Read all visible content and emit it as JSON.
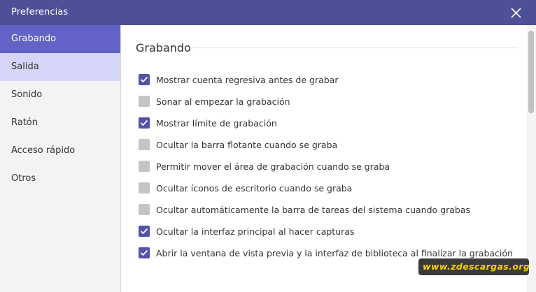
{
  "window": {
    "title": "Preferencias"
  },
  "colors": {
    "titlebar": "#4e4f99",
    "accent": "#6163c6",
    "hover": "#d5d6f7",
    "checkbox_on": "#5352a8",
    "checkbox_off": "#c4c4c4"
  },
  "icons": {
    "close": "close-icon",
    "check": "checkmark-icon"
  },
  "sidebar": {
    "items": [
      {
        "label": "Grabando",
        "state": "selected"
      },
      {
        "label": "Salida",
        "state": "hover"
      },
      {
        "label": "Sonido",
        "state": "normal"
      },
      {
        "label": "Ratón",
        "state": "normal"
      },
      {
        "label": "Acceso rápido",
        "state": "normal"
      },
      {
        "label": "Otros",
        "state": "normal"
      }
    ]
  },
  "section": {
    "title": "Grabando",
    "options": [
      {
        "label": "Mostrar cuenta regresiva antes de grabar",
        "checked": true
      },
      {
        "label": "Sonar al empezar la grabación",
        "checked": false
      },
      {
        "label": "Mostrar límite de grabación",
        "checked": true
      },
      {
        "label": "Ocultar la barra flotante cuando se graba",
        "checked": false
      },
      {
        "label": "Permitir mover el área de grabación cuando se graba",
        "checked": false
      },
      {
        "label": "Ocultar íconos de escritorio cuando se graba",
        "checked": false
      },
      {
        "label": "Ocultar automáticamente la barra de tareas del sistema cuando grabas",
        "checked": false
      },
      {
        "label": "Ocultar la interfaz principal al hacer capturas",
        "checked": true
      },
      {
        "label": "Abrir la ventana de vista previa y la interfaz de biblioteca al finalizar la grabación",
        "checked": true
      }
    ]
  },
  "watermark": {
    "text": "www.zdescargas.org"
  }
}
